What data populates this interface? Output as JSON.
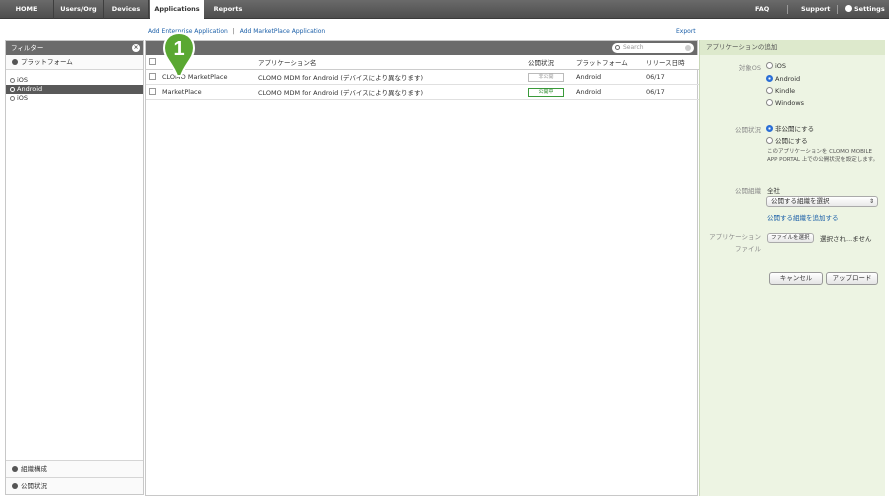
{
  "nav": {
    "tabs": [
      "HOME",
      "Users/Org",
      "Devices",
      "Applications",
      "Reports"
    ],
    "active": "Applications",
    "right": [
      "FAQ",
      "Support",
      "Settings"
    ]
  },
  "subbar": {
    "add_enterprise": "Add Enterprise Application",
    "separator": "|",
    "add_marketplace": "Add MarketPlace Application",
    "export": "Export"
  },
  "callout": {
    "number": "1",
    "color": "#5aa832"
  },
  "sidebar": {
    "title": "フィルター",
    "close_icon": "close-circle-icon",
    "platform_header": "プラットフォーム",
    "platforms": [
      {
        "label": "iOS",
        "selected": false,
        "radio": false
      },
      {
        "label": "Android",
        "selected": true,
        "radio": true
      },
      {
        "label": "iOS",
        "selected": false,
        "radio": true
      }
    ],
    "bottom_sections": [
      "組織構成",
      "公開状況"
    ]
  },
  "table": {
    "search_placeholder": "Search",
    "columns": [
      "",
      "",
      "アプリケーション名",
      "公開状況",
      "プラットフォーム",
      "リリース日時"
    ],
    "rows": [
      {
        "name": "CLOMO MarketPlace",
        "app_name": "CLOMO MDM for Android (デバイスにより異なります)",
        "status": "非公開",
        "status_on": false,
        "platform": "Android",
        "date": "06/17"
      },
      {
        "name": "MarketPlace",
        "app_name": "CLOMO MDM for Android (デバイスにより異なります)",
        "status": "公開中",
        "status_on": true,
        "platform": "Android",
        "date": "06/17"
      }
    ]
  },
  "form": {
    "title": "アプリケーションの追加",
    "os_label": "対象OS",
    "os_options": [
      {
        "label": "iOS",
        "checked": false
      },
      {
        "label": "Android",
        "checked": true
      },
      {
        "label": "Kindle",
        "checked": false
      },
      {
        "label": "Windows",
        "checked": false
      }
    ],
    "publish_label": "公開状況",
    "publish_options": [
      {
        "label": "非公開にする",
        "checked": true
      },
      {
        "label": "公開にする",
        "checked": false
      }
    ],
    "publish_note": "このアプリケーションを CLOMO MOBILE APP PORTAL 上での公開状況を設定します。",
    "org_label": "公開組織",
    "org_value": "全社",
    "org_select": "公開する組織を選択",
    "add_org": "公開する組織を追加する",
    "file_label_1": "アプリケーション",
    "file_label_2": "ファイル",
    "file_button": "ファイルを選択",
    "file_status": "選択され...ません",
    "cancel": "キャンセル",
    "upload": "アップロード"
  }
}
